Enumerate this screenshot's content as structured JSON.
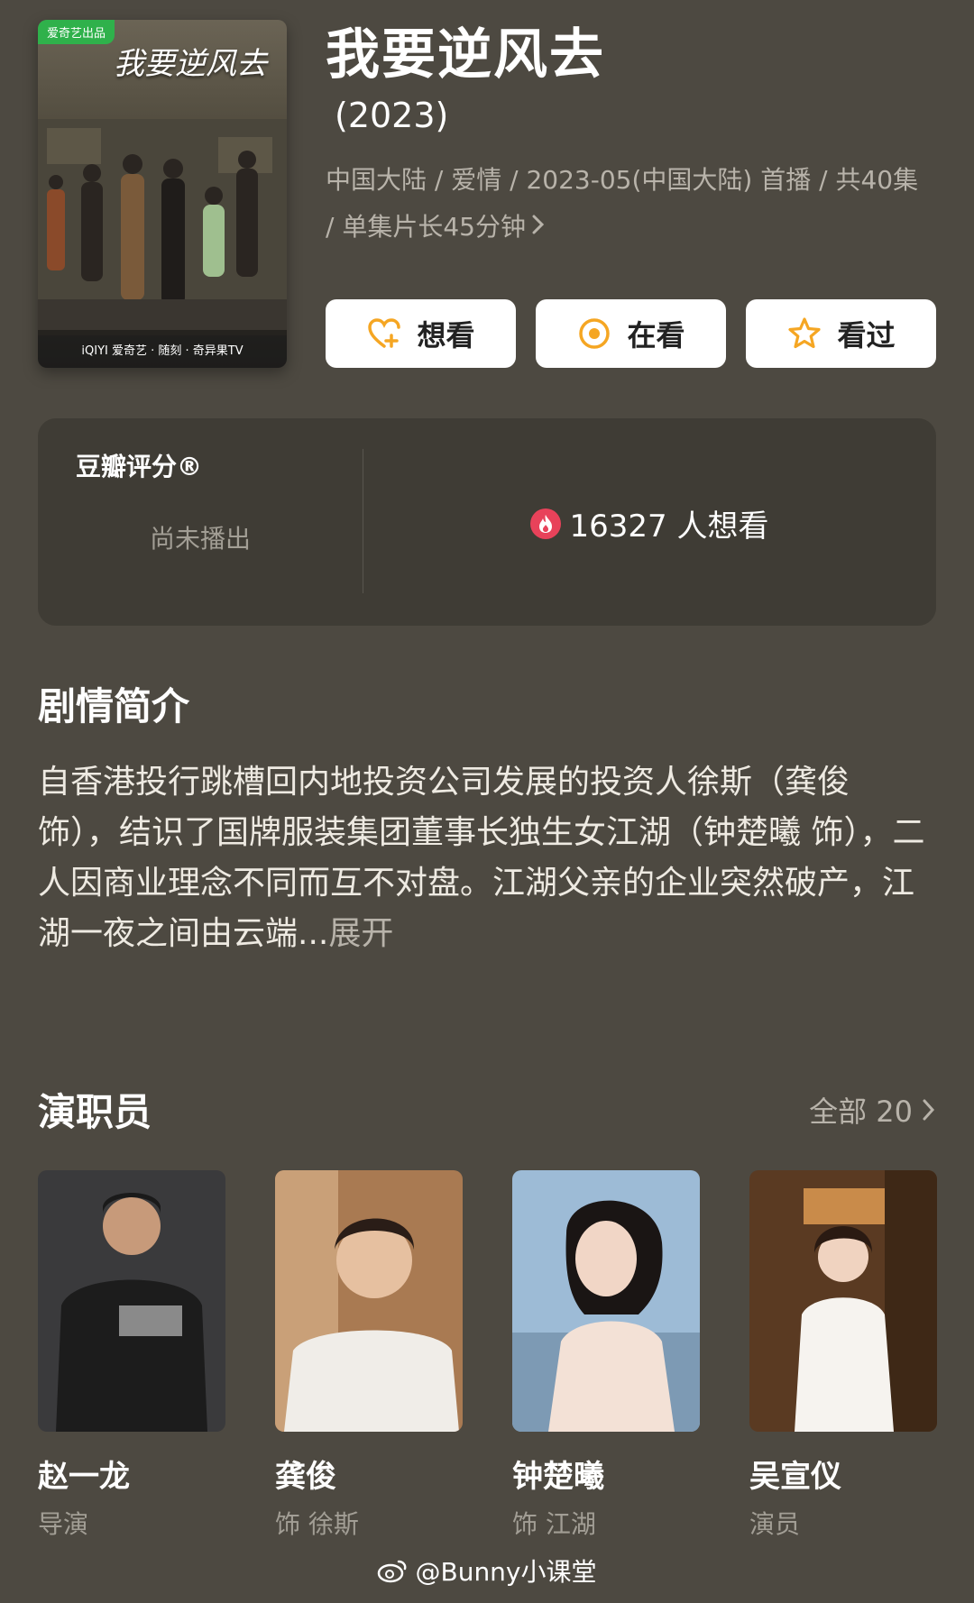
{
  "poster": {
    "badge": "爱奇艺出品",
    "title_art": "我要逆风去",
    "footer": "iQIYI 爱奇艺 · 随刻 · 奇异果TV"
  },
  "header": {
    "title": "我要逆风去",
    "year": "(2023)",
    "meta": "中国大陆 / 爱情 / 2023-05(中国大陆) 首播 / 共40集 / 单集片长45分钟"
  },
  "actions": [
    {
      "label": "想看",
      "icon": "heart-plus-icon"
    },
    {
      "label": "在看",
      "icon": "target-icon"
    },
    {
      "label": "看过",
      "icon": "star-icon"
    }
  ],
  "rating": {
    "label": "豆瓣评分®",
    "status": "尚未播出",
    "wish": "16327 人想看"
  },
  "synopsis": {
    "title": "剧情简介",
    "text": "自香港投行跳槽回内地投资公司发展的投资人徐斯（龚俊 饰），结识了国牌服装集团董事长独生女江湖（钟楚曦 饰），二人因商业理念不同而互不对盘。江湖父亲的企业突然破产，江湖一夜之间由云端...",
    "expand": "展开"
  },
  "cast": {
    "title": "演职员",
    "see_all": "全部 20",
    "members": [
      {
        "name": "赵一龙",
        "role": "导演"
      },
      {
        "name": "龚俊",
        "role": "饰 徐斯"
      },
      {
        "name": "钟楚曦",
        "role": "饰 江湖"
      },
      {
        "name": "吴宣仪",
        "role": "演员"
      }
    ]
  },
  "watermark": "@Bunny小课堂",
  "colors": {
    "background": "#4d4941",
    "card": "#3f3c35",
    "accent": "#f5a623",
    "fire": "#e8425a"
  }
}
